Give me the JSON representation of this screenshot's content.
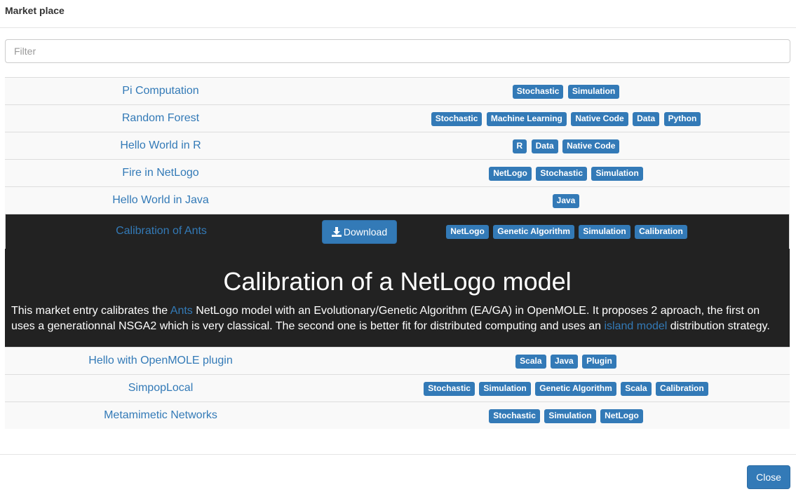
{
  "modal": {
    "title": "Market place",
    "close_label": "Close"
  },
  "filter": {
    "placeholder": "Filter",
    "value": ""
  },
  "entries_before": [
    {
      "name": "Pi Computation",
      "tags": [
        "Stochastic",
        "Simulation"
      ]
    },
    {
      "name": "Random Forest",
      "tags": [
        "Stochastic",
        "Machine Learning",
        "Native Code",
        "Data",
        "Python"
      ]
    },
    {
      "name": "Hello World in R",
      "tags": [
        "R",
        "Data",
        "Native Code"
      ]
    },
    {
      "name": "Fire in NetLogo",
      "tags": [
        "NetLogo",
        "Stochastic",
        "Simulation"
      ]
    },
    {
      "name": "Hello World in Java",
      "tags": [
        "Java"
      ]
    }
  ],
  "selected": {
    "name": "Calibration of Ants",
    "download_label": "Download",
    "tags": [
      "NetLogo",
      "Genetic Algorithm",
      "Simulation",
      "Calibration"
    ],
    "heading": "Calibration of a NetLogo model",
    "desc_1": "This market entry calibrates the ",
    "link_ants": "Ants",
    "desc_2": " NetLogo model with an Evolutionary/Genetic Algorithm (EA/GA) in OpenMOLE. It proposes 2 aproach, the first on uses a generationnal NSGA2 which is very classical. The second one is better fit for distributed computing and uses an ",
    "link_island": "island model",
    "desc_3": " distribution strategy."
  },
  "entries_after": [
    {
      "name": "Hello with OpenMOLE plugin",
      "tags": [
        "Scala",
        "Java",
        "Plugin"
      ]
    },
    {
      "name": "SimpopLocal",
      "tags": [
        "Stochastic",
        "Simulation",
        "Genetic Algorithm",
        "Scala",
        "Calibration"
      ]
    },
    {
      "name": "Metamimetic Networks",
      "tags": [
        "Stochastic",
        "Simulation",
        "NetLogo"
      ]
    }
  ],
  "colors": {
    "accent": "#337ab7",
    "selected_bg": "#222222",
    "row_bg": "#f9f9f9"
  },
  "icons": {
    "download": "download-icon"
  }
}
